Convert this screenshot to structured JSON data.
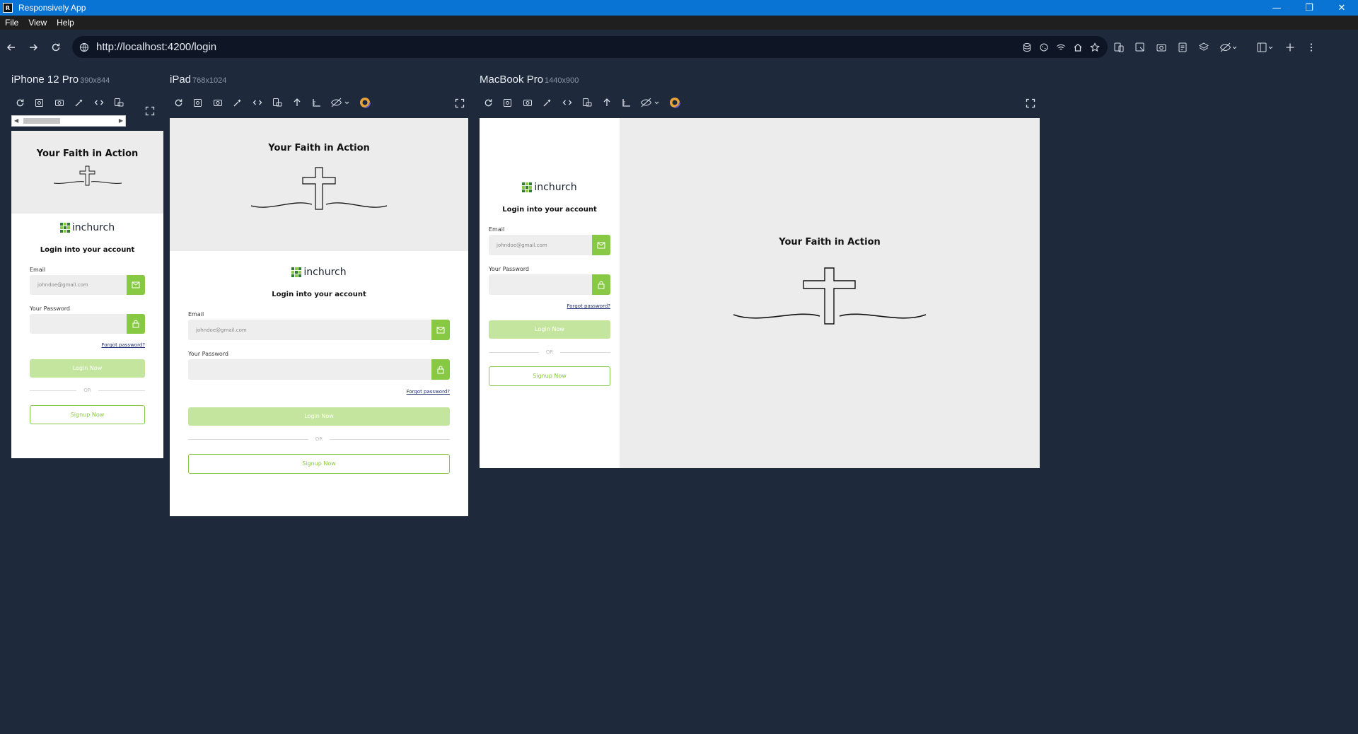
{
  "window": {
    "title": "Responsively App",
    "minimize": "—",
    "restore": "❐",
    "close": "✕"
  },
  "menu": [
    "File",
    "View",
    "Help"
  ],
  "address": {
    "url": "http://localhost:4200/login"
  },
  "devices": [
    {
      "name": "iPhone 12 Pro",
      "res": "390x844"
    },
    {
      "name": "iPad",
      "res": "768x1024"
    },
    {
      "name": "MacBook Pro",
      "res": "1440x900"
    }
  ],
  "page": {
    "hero_title": "Your Faith in Action",
    "brand": "inchurch",
    "heading": "Login into your account",
    "email_label": "Email",
    "email_value": "johndoe@gmail.com",
    "password_label": "Your Password",
    "forgot": "Forgot password?",
    "login_btn": "Login Now",
    "or": "OR",
    "signup_btn": "Signup Now"
  },
  "colors": {
    "accent": "#88c943",
    "accent_light": "#c4e59d",
    "titlebar": "#0a74d5",
    "bg": "#1e2a3c",
    "hero": "#ececec"
  },
  "icons": [
    "back-arrow-icon",
    "forward-arrow-icon",
    "reload-icon",
    "globe-icon",
    "mail-icon",
    "lock-icon",
    "expand-icon",
    "cross-icon"
  ]
}
